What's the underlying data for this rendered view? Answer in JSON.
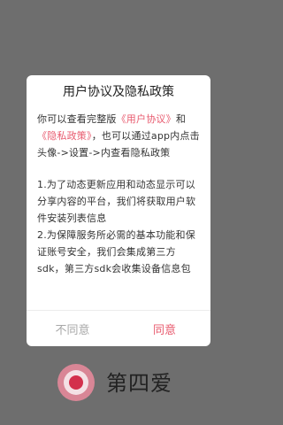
{
  "dialog": {
    "title": "用户协议及隐私政策",
    "intro_prefix": "你可以查看完整版",
    "user_agreement_link": "《用户协议》",
    "and_text": "和",
    "privacy_policy_link": "《隐私政策》",
    "intro_suffix": "，也可以通过app内点击头像->设置->内查看隐私政策",
    "item_1": "1.为了动态更新应用和动态显示可以分享内容的平台，我们将获取用户软件安装列表信息",
    "item_2": "2.为保障服务所必需的基本功能和保证账号安全，我们会集成第三方sdk，第三方sdk会收集设备信息包",
    "decline_label": "不同意",
    "agree_label": "同意"
  },
  "brand": {
    "name": "第四爱",
    "logo_icon": "brand-logo-icon"
  },
  "colors": {
    "overlay": "#6e6e6e",
    "accent": "#e85a6e",
    "muted": "#a8a8a8"
  }
}
